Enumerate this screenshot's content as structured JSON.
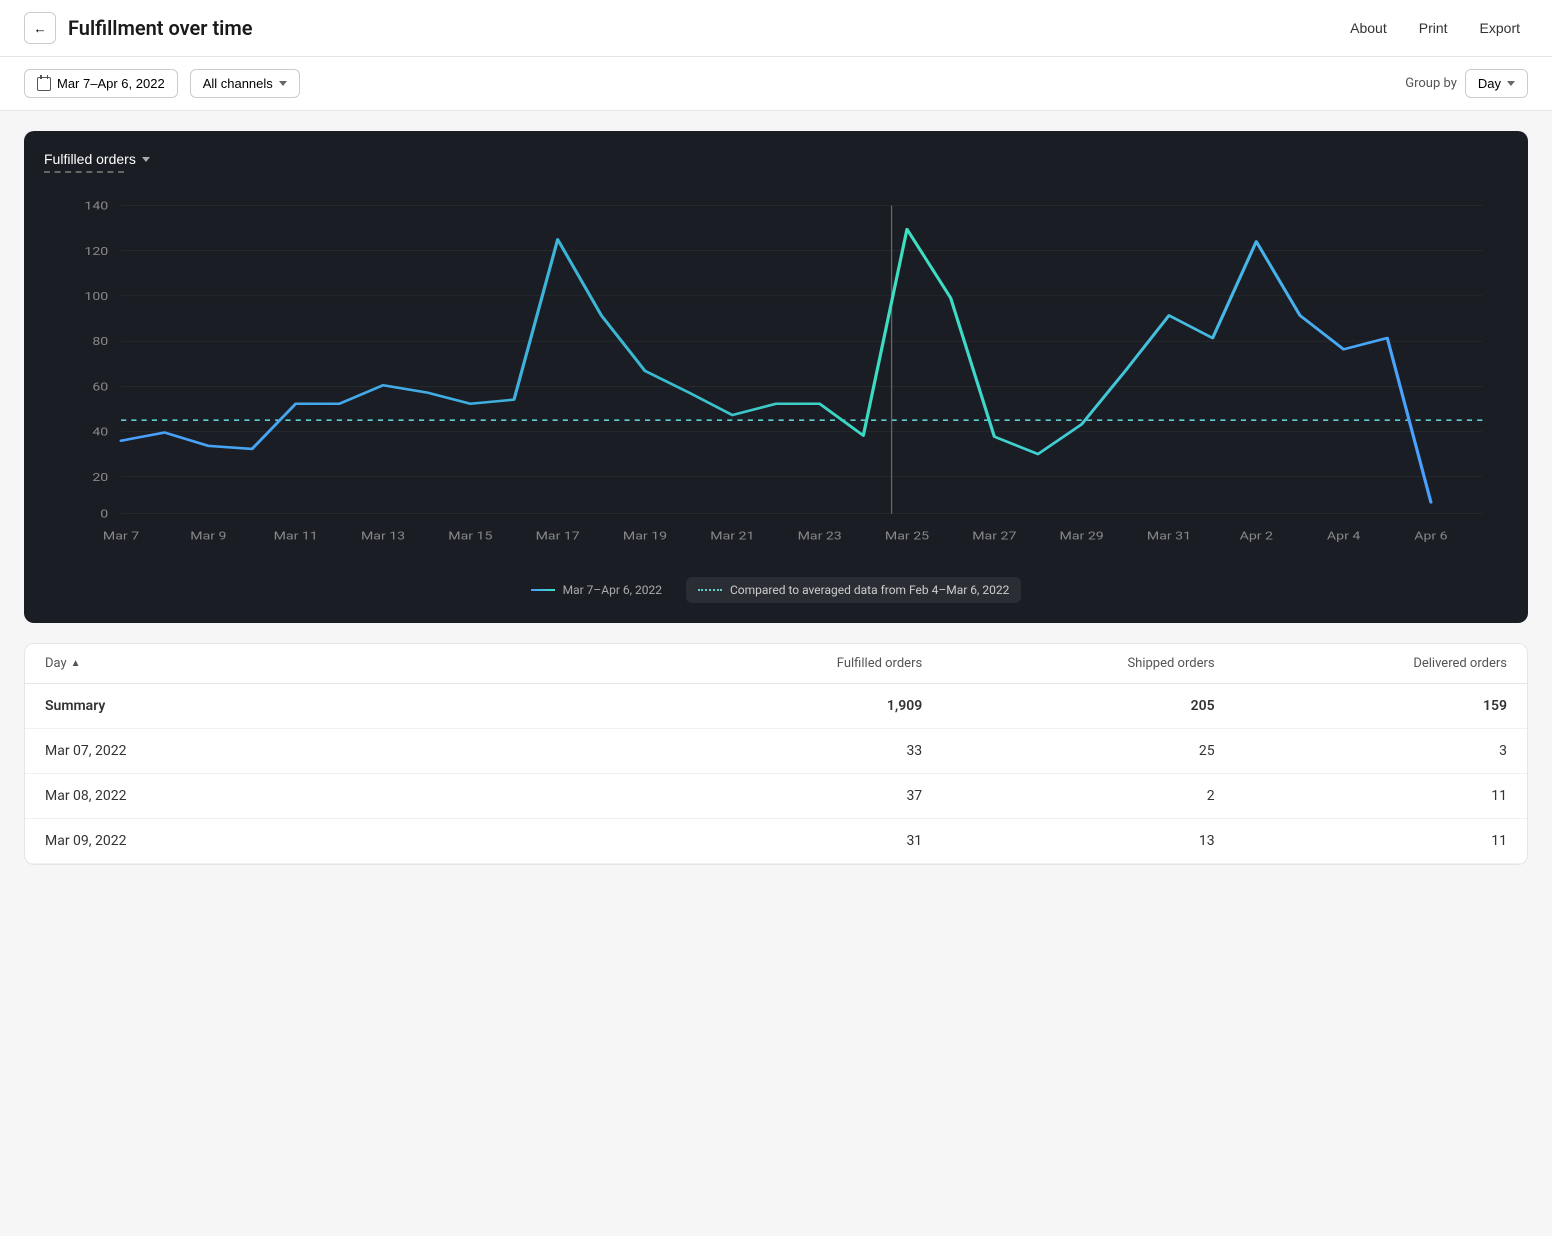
{
  "header": {
    "back_label": "←",
    "title": "Fulfillment over time",
    "about_label": "About",
    "print_label": "Print",
    "export_label": "Export"
  },
  "toolbar": {
    "date_range": "Mar 7–Apr 6, 2022",
    "channel": "All channels",
    "group_by_label": "Group by",
    "group_by_value": "Day"
  },
  "chart": {
    "title": "Fulfilled orders",
    "legend_current": "Mar 7–Apr 6, 2022",
    "legend_compared": "Compared to averaged data from Feb 4–Mar 6, 2022",
    "y_labels": [
      "0",
      "20",
      "40",
      "60",
      "80",
      "100",
      "120",
      "140"
    ],
    "x_labels": [
      "Mar 7",
      "Mar 9",
      "Mar 11",
      "Mar 13",
      "Mar 15",
      "Mar 17",
      "Mar 19",
      "Mar 21",
      "Mar 23",
      "Mar 25",
      "Mar 27",
      "Mar 29",
      "Mar 31",
      "Apr 2",
      "Apr 4",
      "Apr 6"
    ]
  },
  "table": {
    "columns": [
      "Day",
      "Fulfilled orders",
      "Shipped orders",
      "Delivered orders"
    ],
    "summary": {
      "label": "Summary",
      "fulfilled": "1,909",
      "shipped": "205",
      "delivered": "159"
    },
    "rows": [
      {
        "day": "Mar 07, 2022",
        "fulfilled": "33",
        "shipped": "25",
        "delivered": "3"
      },
      {
        "day": "Mar 08, 2022",
        "fulfilled": "37",
        "shipped": "2",
        "delivered": "11"
      },
      {
        "day": "Mar 09, 2022",
        "fulfilled": "31",
        "shipped": "13",
        "delivered": "11"
      }
    ]
  }
}
